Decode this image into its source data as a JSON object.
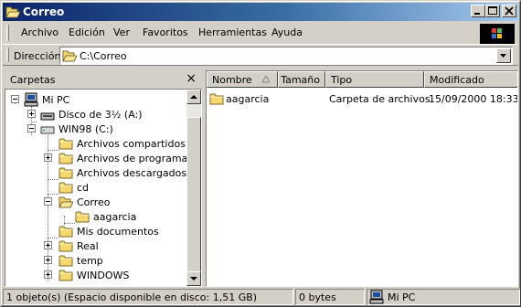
{
  "window": {
    "title": "Correo"
  },
  "menu": {
    "items": [
      "Archivo",
      "Edición",
      "Ver",
      "Favoritos",
      "Herramientas",
      "Ayuda"
    ]
  },
  "address": {
    "label": "Dirección",
    "value": "C:\\Correo"
  },
  "folders_pane": {
    "title": "Carpetas",
    "close_symbol": "×"
  },
  "tree": [
    {
      "label": "Mi PC",
      "icon": "my-computer-icon",
      "expand": "minus"
    },
    {
      "label": "Disco de 3½ (A:)",
      "icon": "floppy-drive-icon",
      "expand": "plus"
    },
    {
      "label": "WIN98 (C:)",
      "icon": "hard-drive-icon",
      "expand": "minus"
    },
    {
      "label": "Archivos compartidos",
      "icon": "folder-icon",
      "expand": "none"
    },
    {
      "label": "Archivos de programa",
      "icon": "folder-icon",
      "expand": "plus"
    },
    {
      "label": "Archivos descargados",
      "icon": "folder-icon",
      "expand": "none"
    },
    {
      "label": "cd",
      "icon": "folder-icon",
      "expand": "none"
    },
    {
      "label": "Correo",
      "icon": "open-folder-icon",
      "expand": "minus"
    },
    {
      "label": "aagarcia",
      "icon": "folder-icon",
      "expand": "none"
    },
    {
      "label": "Mis documentos",
      "icon": "folder-icon",
      "expand": "none"
    },
    {
      "label": "Real",
      "icon": "folder-icon",
      "expand": "plus"
    },
    {
      "label": "temp",
      "icon": "folder-icon",
      "expand": "plus"
    },
    {
      "label": "WINDOWS",
      "icon": "folder-icon",
      "expand": "plus"
    }
  ],
  "list": {
    "columns": [
      "Nombre",
      "Tamaño",
      "Tipo",
      "Modificado"
    ],
    "rows": [
      {
        "name": "aagarcia",
        "size": "",
        "type": "Carpeta de archivos",
        "modified": "15/09/2000 18:33"
      }
    ]
  },
  "status": {
    "objects": "1 objeto(s) (Espacio disponible en disco: 1,51 GB)",
    "size": "0 bytes",
    "location": "Mi PC"
  },
  "colors": {
    "titlebar_start": "#0a246a",
    "titlebar_end": "#a6caf0",
    "folder_yellow": "#f5d76e"
  }
}
